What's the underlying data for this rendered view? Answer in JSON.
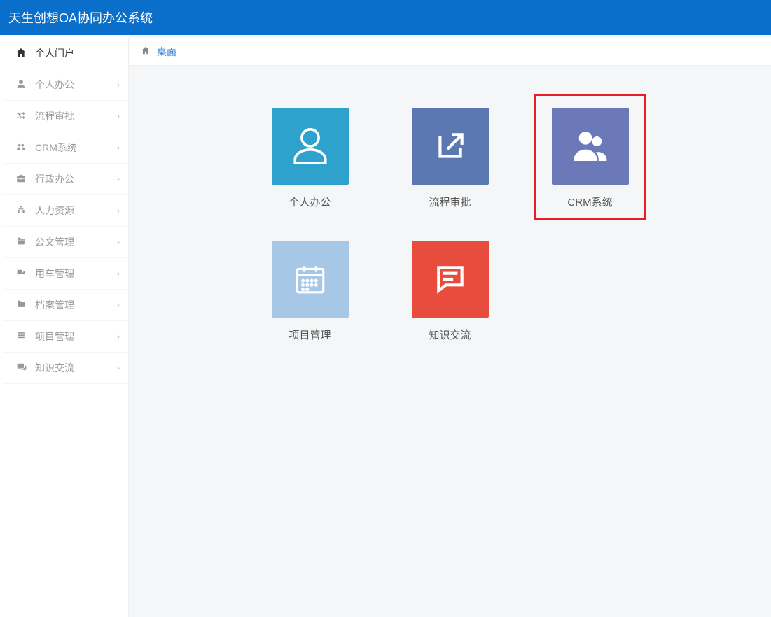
{
  "header": {
    "title": "天生创想OA协同办公系统"
  },
  "breadcrumb": {
    "label": "桌面"
  },
  "sidebar": {
    "items": [
      {
        "label": "个人门户",
        "icon": "home",
        "active": true,
        "expandable": false
      },
      {
        "label": "个人办公",
        "icon": "user",
        "active": false,
        "expandable": true
      },
      {
        "label": "流程审批",
        "icon": "random",
        "active": false,
        "expandable": true
      },
      {
        "label": "CRM系统",
        "icon": "group",
        "active": false,
        "expandable": true
      },
      {
        "label": "行政办公",
        "icon": "briefcase",
        "active": false,
        "expandable": true
      },
      {
        "label": "人力资源",
        "icon": "sitemap",
        "active": false,
        "expandable": true
      },
      {
        "label": "公文管理",
        "icon": "folder",
        "active": false,
        "expandable": true
      },
      {
        "label": "用车管理",
        "icon": "truck",
        "active": false,
        "expandable": true
      },
      {
        "label": "档案管理",
        "icon": "folder2",
        "active": false,
        "expandable": true
      },
      {
        "label": "项目管理",
        "icon": "list",
        "active": false,
        "expandable": true
      },
      {
        "label": "知识交流",
        "icon": "comments",
        "active": false,
        "expandable": true
      }
    ]
  },
  "tiles": [
    {
      "label": "个人办公",
      "color": "c-blue1",
      "icon": "person"
    },
    {
      "label": "流程审批",
      "color": "c-blue2",
      "icon": "share"
    },
    {
      "label": "CRM系统",
      "color": "c-purple",
      "icon": "users",
      "highlighted": true
    },
    {
      "label": "项目管理",
      "color": "c-lblue",
      "icon": "calendar"
    },
    {
      "label": "知识交流",
      "color": "c-red",
      "icon": "chat"
    }
  ]
}
